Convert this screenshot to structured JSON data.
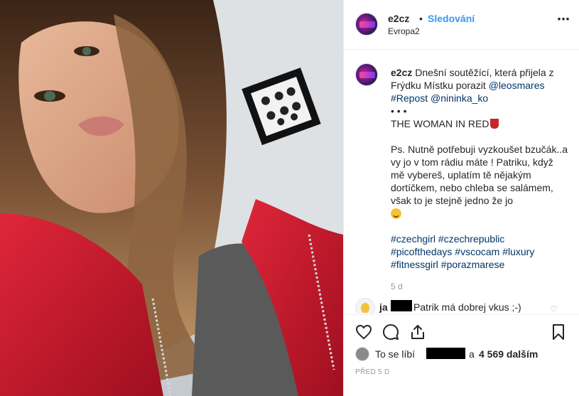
{
  "post": {
    "username": "e2cz",
    "separator": "•",
    "follow_label": "Sledování",
    "location": "Evropa2",
    "more_icon": "⋯"
  },
  "caption": {
    "username": "e2cz",
    "line1": "Dnešní soutěžící, která přijela z Frýdku Místku porazit ",
    "mention1": "@leosmares",
    "hashtag_repost": "#Repost",
    "mention2": "@nininka_ko",
    "dots": "•   •   •",
    "title": "THE WOMAN IN RED",
    "body": "Ps. Nutně potřebuji vyzkoušet bzučák..a vy jo v tom rádiu máte ! Patriku, když mě vybereš, uplatím tě nějakým dortíčkem, nebo chleba se salámem, však to je stejně jedno že jo",
    "hashtags_line1": "#czechgirl #czechrepublic",
    "hashtags_line2": "#picofthedays #vscocam #luxury",
    "hashtags_line3": "#fitnessgirl #porazmarese",
    "time": "5 d"
  },
  "comment": {
    "user_prefix": "ja",
    "text": "Patrik má dobrej vkus ;-)"
  },
  "likes": {
    "prefix": "To se líbí",
    "and": "a",
    "count_text": "4 569 dalším"
  },
  "posted": "PŘED 5 D",
  "icons": [
    "heart-icon",
    "comment-icon",
    "share-icon",
    "bookmark-icon"
  ],
  "colors": {
    "link": "#3897f0",
    "mention": "#003569",
    "jacket": "#c8102e"
  }
}
